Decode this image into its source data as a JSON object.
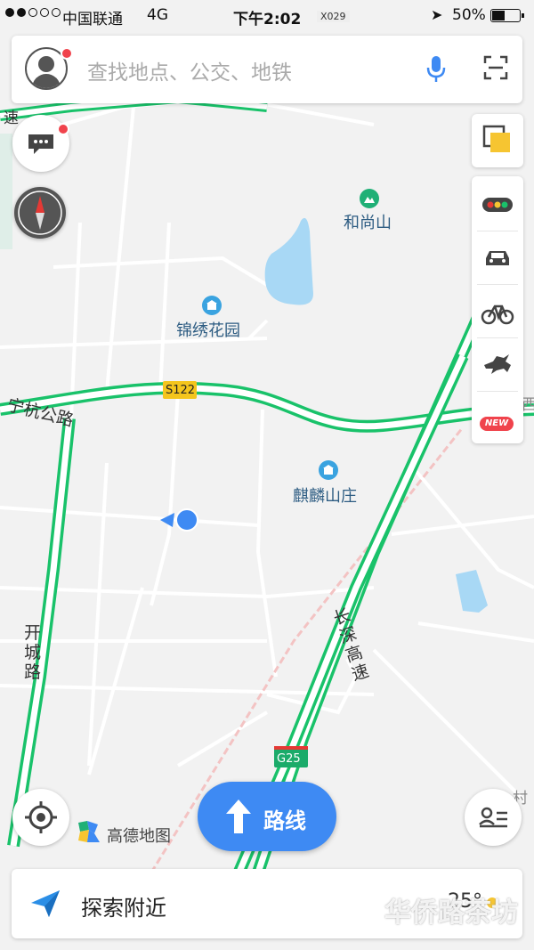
{
  "status_bar": {
    "carrier": "中国联通",
    "network": "4G",
    "time": "下午2:02",
    "tag": "X029",
    "battery": "50%",
    "battery_level": 0.5
  },
  "search": {
    "placeholder": "查找地点、公交、地铁"
  },
  "map_labels": {
    "road_s122": "S122",
    "road_g25": "G25",
    "road_ninghang": "宁杭公路",
    "road_kaicheng": "开城路",
    "road_changshen": "长深高速",
    "road_su_left": "速",
    "poi_heshangshan": "和尚山",
    "poi_jinxiu": "锦绣花园",
    "poi_qilin": "麒麟山庄",
    "edge_xi": "西",
    "edge_cun": "村"
  },
  "side_tools": {
    "new_badge": "NEW"
  },
  "route_button": {
    "label": "路线"
  },
  "bottom_bar": {
    "label": "探索附近",
    "temperature": "25°"
  },
  "logo": {
    "text": "高德地图"
  },
  "watermark": "华侨路茶坊",
  "colors": {
    "road_green": "#19c26a",
    "accent_blue": "#3e8af3",
    "water": "#a8d8f5",
    "poi_text": "#2d5c82"
  }
}
